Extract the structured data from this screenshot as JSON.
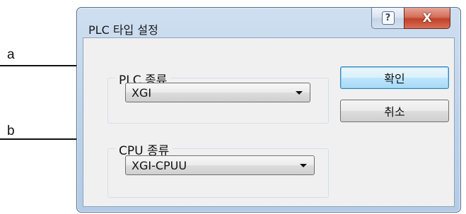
{
  "callouts": [
    {
      "label": "a"
    },
    {
      "label": "b"
    }
  ],
  "window": {
    "title": "PLC 타입 설정",
    "help_glyph": "?",
    "close_glyph": "X"
  },
  "plc_group": {
    "legend": "PLC 종류",
    "selected": "XGI"
  },
  "cpu_group": {
    "legend": "CPU 종류",
    "selected": "XGI-CPUU"
  },
  "buttons": {
    "ok": "확인",
    "cancel": "취소"
  },
  "colors": {
    "title_bar": "#bcd2ea",
    "close_button": "#c0422a",
    "default_button_border": "#3c7fb1",
    "client_bg": "#f0f0f0"
  }
}
